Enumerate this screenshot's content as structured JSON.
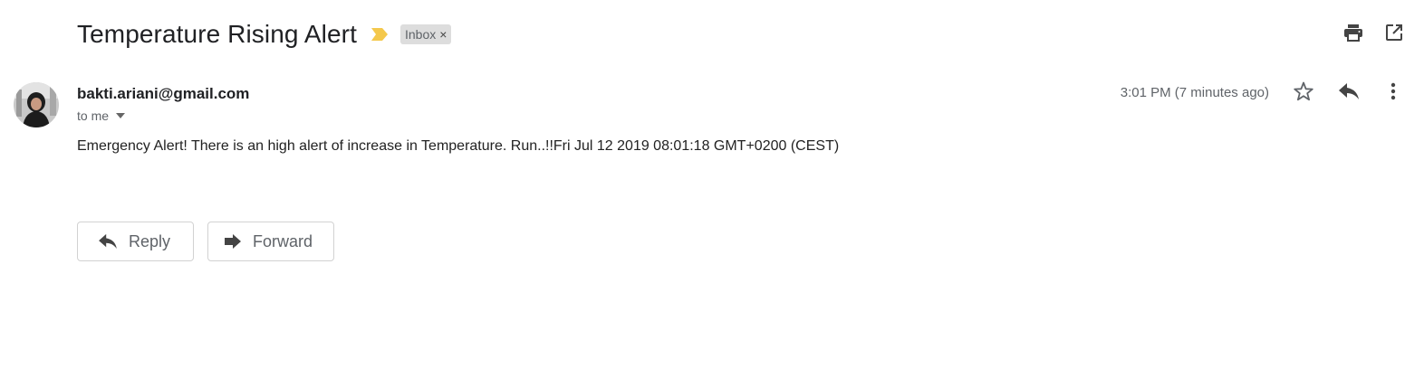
{
  "email": {
    "subject": "Temperature Rising Alert",
    "label": "Inbox",
    "label_remove": "×",
    "sender": "bakti.ariani@gmail.com",
    "recipient": "to me",
    "timestamp": "3:01 PM (7 minutes ago)",
    "body": "Emergency Alert! There is an high alert of increase in Temperature. Run..!!Fri Jul 12 2019 08:01:18 GMT+0200 (CEST)"
  },
  "actions": {
    "reply_label": "Reply",
    "forward_label": "Forward"
  },
  "icons": {
    "importance": "importance-marker-icon",
    "print": "print-icon",
    "new_window": "open-in-new-window-icon",
    "star": "star-icon",
    "reply": "reply-icon",
    "more": "more-vertical-icon",
    "caret": "caret-down-icon",
    "forward": "forward-icon"
  },
  "colors": {
    "importance_marker": "#f4c84c",
    "label_chip_bg": "#dddddd",
    "icon_dark": "#5f6368"
  }
}
